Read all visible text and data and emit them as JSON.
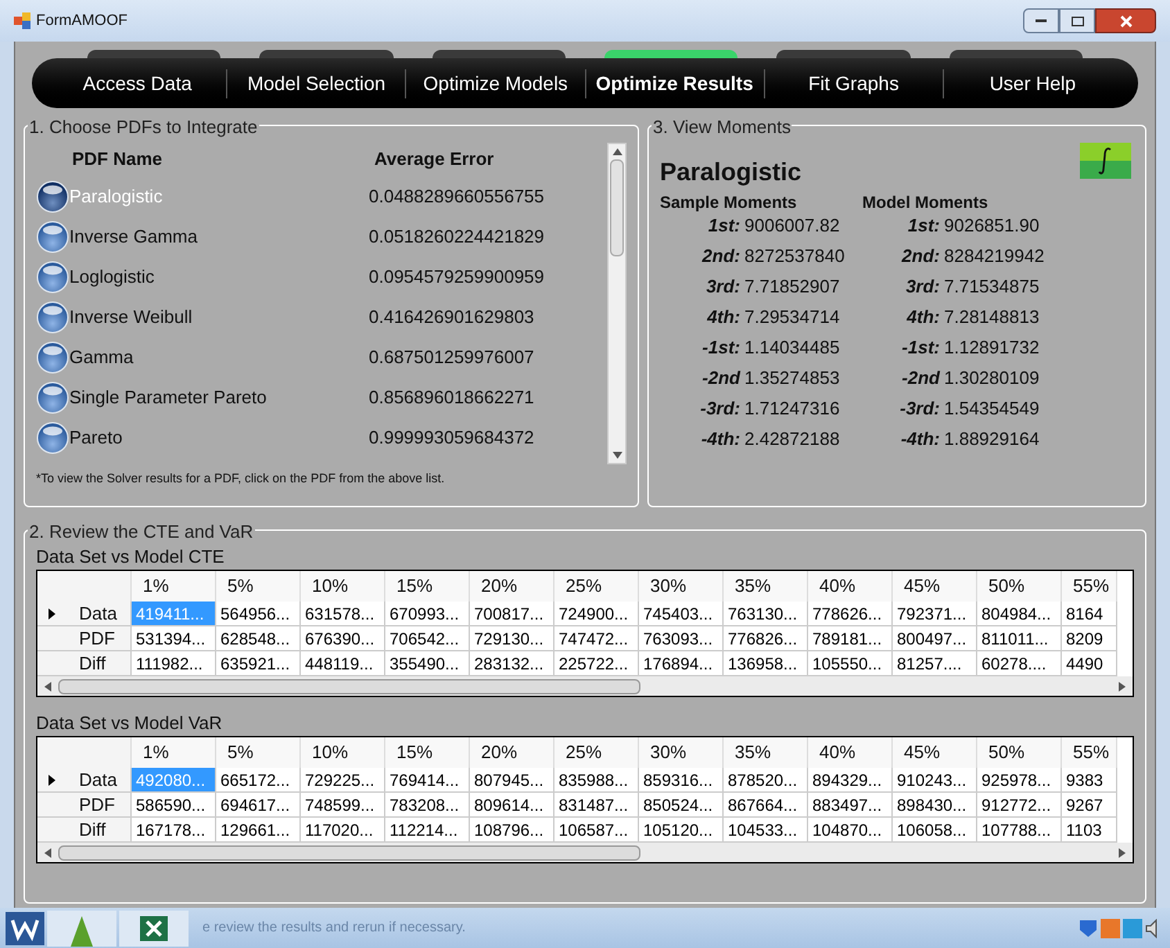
{
  "window": {
    "title": "FormAMOOF"
  },
  "tabs": [
    {
      "label": "Access Data",
      "selected": false
    },
    {
      "label": "Model Selection",
      "selected": false
    },
    {
      "label": "Optimize Models",
      "selected": false
    },
    {
      "label": "Optimize Results",
      "selected": true
    },
    {
      "label": "Fit Graphs",
      "selected": false
    },
    {
      "label": "User Help",
      "selected": false
    }
  ],
  "pdf_panel": {
    "title": "1. Choose PDFs to Integrate",
    "columns": [
      "PDF Name",
      "Average Error"
    ],
    "items": [
      {
        "name": "Paralogistic",
        "error": "0.0488289660556755",
        "selected": true
      },
      {
        "name": "Inverse Gamma",
        "error": "0.0518260224421829",
        "selected": false
      },
      {
        "name": "Loglogistic",
        "error": "0.0954579259900959",
        "selected": false
      },
      {
        "name": "Inverse Weibull",
        "error": "0.416426901629803",
        "selected": false
      },
      {
        "name": "Gamma",
        "error": "0.687501259976007",
        "selected": false
      },
      {
        "name": "Single Parameter Pareto",
        "error": "0.856896018662271",
        "selected": false
      },
      {
        "name": "Pareto",
        "error": "0.999993059684372",
        "selected": false
      }
    ],
    "note": "*To view the Solver results for a PDF, click on the PDF from the above list."
  },
  "moments_panel": {
    "title": "3. View Moments",
    "model": "Paralogistic",
    "sample_heading": "Sample Moments",
    "model_heading": "Model Moments",
    "rows": [
      {
        "sample_label": "1st:",
        "sample": "9006007.82",
        "model_label": "1st:",
        "model": "9026851.90"
      },
      {
        "sample_label": "2nd:",
        "sample": "8272537840",
        "model_label": "2nd:",
        "model": "8284219942"
      },
      {
        "sample_label": "3rd:",
        "sample": "7.71852907",
        "model_label": "3rd:",
        "model": "7.71534875"
      },
      {
        "sample_label": "4th:",
        "sample": "7.29534714",
        "model_label": "4th:",
        "model": "7.28148813"
      },
      {
        "sample_label": "-1st:",
        "sample": "1.14034485",
        "model_label": "-1st:",
        "model": "1.12891732"
      },
      {
        "sample_label": "-2nd",
        "sample": "1.35274853",
        "model_label": "-2nd",
        "model": "1.30280109"
      },
      {
        "sample_label": "-3rd:",
        "sample": "1.71247316",
        "model_label": "-3rd:",
        "model": "1.54354549"
      },
      {
        "sample_label": "-4th:",
        "sample": "2.42872188",
        "model_label": "-4th:",
        "model": "1.88929164"
      }
    ]
  },
  "review_panel": {
    "title": "2. Review the CTE and VaR",
    "tables": [
      {
        "title": "Data Set vs Model CTE",
        "columns": [
          "1%",
          "5%",
          "10%",
          "15%",
          "20%",
          "25%",
          "30%",
          "35%",
          "40%",
          "45%",
          "50%",
          "55%"
        ],
        "rows": [
          {
            "label": "Data",
            "current": true,
            "cells": [
              "419411...",
              "564956...",
              "631578...",
              "670993...",
              "700817...",
              "724900...",
              "745403...",
              "763130...",
              "778626...",
              "792371...",
              "804984...",
              "8164"
            ]
          },
          {
            "label": "PDF",
            "current": false,
            "cells": [
              "531394...",
              "628548...",
              "676390...",
              "706542...",
              "729130...",
              "747472...",
              "763093...",
              "776826...",
              "789181...",
              "800497...",
              "811011...",
              "8209"
            ]
          },
          {
            "label": "Diff",
            "current": false,
            "cells": [
              "111982...",
              "635921...",
              "448119...",
              "355490...",
              "283132...",
              "225722...",
              "176894...",
              "136958...",
              "105550...",
              "81257....",
              "60278....",
              "4490"
            ]
          }
        ]
      },
      {
        "title": "Data Set vs Model VaR",
        "columns": [
          "1%",
          "5%",
          "10%",
          "15%",
          "20%",
          "25%",
          "30%",
          "35%",
          "40%",
          "45%",
          "50%",
          "55%"
        ],
        "rows": [
          {
            "label": "Data",
            "current": true,
            "cells": [
              "492080...",
              "665172...",
              "729225...",
              "769414...",
              "807945...",
              "835988...",
              "859316...",
              "878520...",
              "894329...",
              "910243...",
              "925978...",
              "9383"
            ]
          },
          {
            "label": "PDF",
            "current": false,
            "cells": [
              "586590...",
              "694617...",
              "748599...",
              "783208...",
              "809614...",
              "831487...",
              "850524...",
              "867664...",
              "883497...",
              "898430...",
              "912772...",
              "9267"
            ]
          },
          {
            "label": "Diff",
            "current": false,
            "cells": [
              "167178...",
              "129661...",
              "117020...",
              "112214...",
              "108796...",
              "106587...",
              "105120...",
              "104533...",
              "104870...",
              "106058...",
              "107788...",
              "1103"
            ]
          }
        ]
      }
    ]
  },
  "taskbar": {
    "text": "e review the results and rerun if necessary."
  }
}
